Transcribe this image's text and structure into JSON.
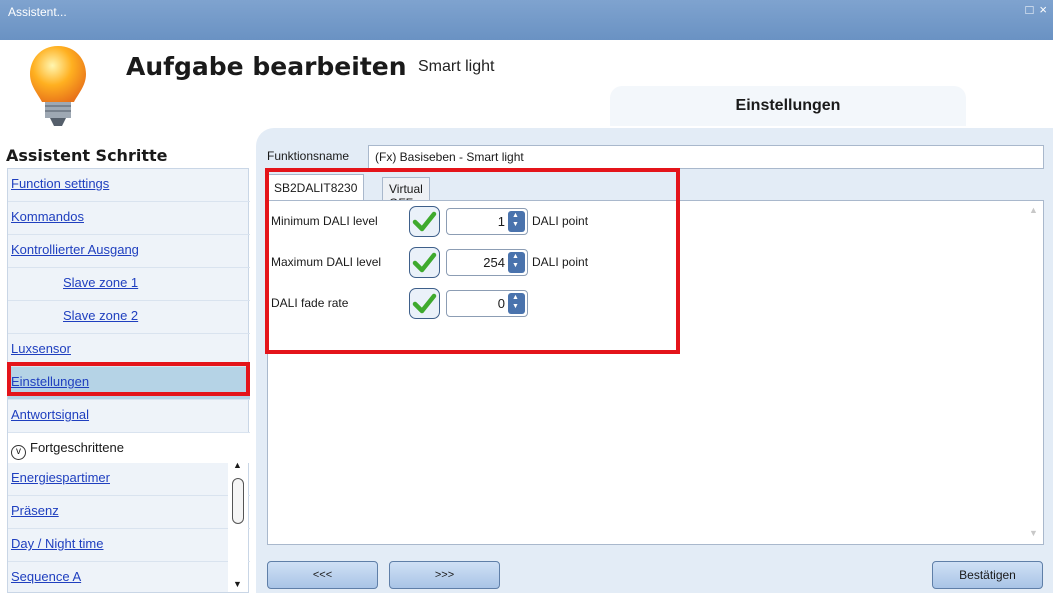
{
  "window": {
    "title": "Assistent...",
    "controls": [
      "maximize-icon",
      "close-icon"
    ]
  },
  "header": {
    "title": "Aufgabe bearbeiten",
    "subtitle": "Smart light",
    "tab": "Einstellungen"
  },
  "sidebar": {
    "heading": "Assistent Schritte",
    "items": [
      {
        "label": "Function settings"
      },
      {
        "label": "Kommandos"
      },
      {
        "label": "Kontrollierter Ausgang"
      },
      {
        "label": "Slave zone 1"
      },
      {
        "label": "Slave zone 2"
      },
      {
        "label": "Luxsensor"
      },
      {
        "label": "Einstellungen",
        "selected": true
      },
      {
        "label": "Antwortsignal"
      }
    ],
    "advanced_label": "Fortgeschrittene",
    "advanced_items": [
      {
        "label": "Energiespartimer"
      },
      {
        "label": "Präsenz"
      },
      {
        "label": "Day / Night time"
      },
      {
        "label": "Sequence A"
      }
    ]
  },
  "main": {
    "function_name_label": "Funktionsname",
    "function_name_value": "(Fx) Basiseben - Smart light",
    "tabs": [
      {
        "label": "SB2DALIT8230"
      },
      {
        "label": "Virtual OFF"
      }
    ],
    "rows": [
      {
        "label": "Minimum DALI level",
        "checked": true,
        "value": "1",
        "unit": "DALI point"
      },
      {
        "label": "Maximum DALI level",
        "checked": true,
        "value": "254",
        "unit": "DALI point"
      },
      {
        "label": "DALI fade rate",
        "checked": true,
        "value": "0",
        "unit": ""
      }
    ]
  },
  "footer": {
    "prev": "<<<",
    "next": ">>>",
    "confirm": "Bestätigen"
  },
  "colors": {
    "highlight_red": "#e4141a",
    "link_blue": "#1f3fbf",
    "check_green": "#3faa2e"
  }
}
